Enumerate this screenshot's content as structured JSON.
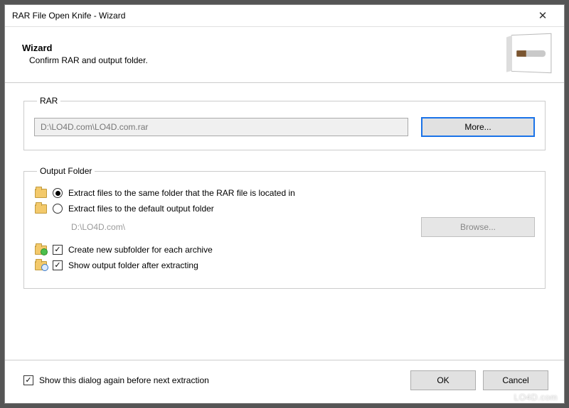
{
  "window": {
    "title": "RAR File Open Knife - Wizard",
    "close": "✕"
  },
  "header": {
    "title": "Wizard",
    "subtitle": "Confirm RAR and output folder."
  },
  "rar": {
    "legend": "RAR",
    "path": "D:\\LO4D.com\\LO4D.com.rar",
    "more_btn": "More..."
  },
  "output": {
    "legend": "Output Folder",
    "opt_same": "Extract files to the same folder that the RAR file is located in",
    "opt_default": "Extract files to the default output folder",
    "default_path": "D:\\LO4D.com\\",
    "browse_btn": "Browse...",
    "chk_subfolder": "Create new subfolder for each archive",
    "chk_show": "Show output folder after extracting"
  },
  "footer": {
    "show_again": "Show this dialog again before next extraction",
    "ok": "OK",
    "cancel": "Cancel"
  },
  "watermark": "LO4D.com"
}
